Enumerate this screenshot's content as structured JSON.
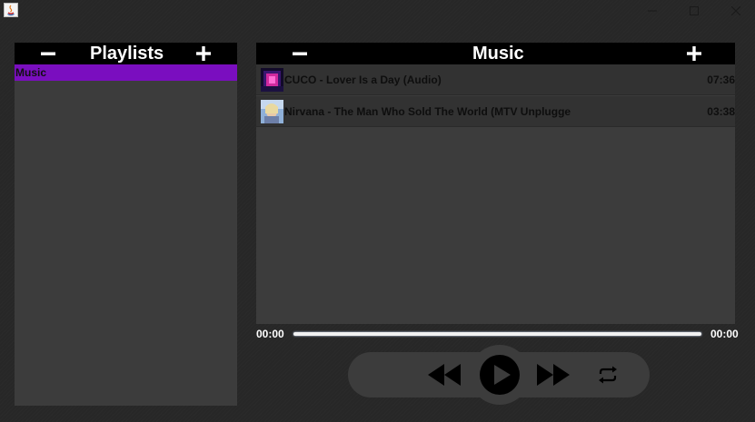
{
  "window": {
    "buttons": {
      "minimize_icon": "minimize-icon",
      "maximize_icon": "maximize-icon",
      "close_icon": "close-icon"
    }
  },
  "playlists_panel": {
    "title": "Playlists",
    "remove_icon": "minus-icon",
    "add_icon": "plus-icon",
    "items": [
      {
        "label": "Music",
        "selected": true
      }
    ]
  },
  "tracks_panel": {
    "title": "Music",
    "remove_icon": "minus-icon",
    "add_icon": "plus-icon",
    "tracks": [
      {
        "title": "CUCO - Lover Is a Day (Audio)",
        "duration": "07:36"
      },
      {
        "title": "Nirvana - The Man Who Sold The World (MTV Unplugge",
        "duration": "03:38"
      }
    ]
  },
  "player": {
    "current_time": "00:00",
    "total_time": "00:00",
    "progress": 0,
    "controls": {
      "previous_icon": "rewind-icon",
      "play_icon": "play-icon",
      "next_icon": "fast-forward-icon",
      "repeat_icon": "repeat-icon"
    }
  },
  "colors": {
    "selection": "#7a0ebf",
    "header_bg": "#000000",
    "panel_bg": "#3c3c3c",
    "window_bg": "#272727"
  }
}
